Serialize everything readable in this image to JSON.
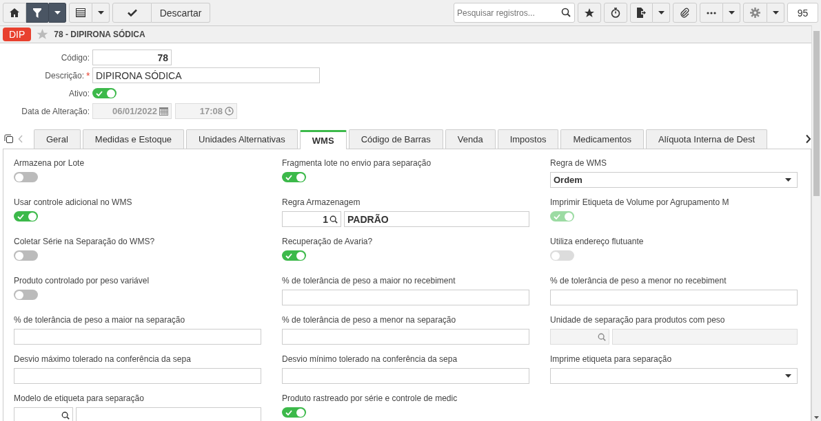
{
  "toolbar": {
    "discard_label": "Descartar",
    "search": {
      "placeholder": "Pesquisar registros..."
    },
    "record_count": "95"
  },
  "record": {
    "badge": "DIP",
    "title": "78 - DIPIRONA SÓDICA",
    "favorite": false
  },
  "header_form": {
    "code": {
      "label": "Código:",
      "value": "78"
    },
    "description": {
      "label": "Descrição:",
      "value": "DIPIRONA SÓDICA",
      "required_mark": "*"
    },
    "active": {
      "label": "Ativo:",
      "on": true
    },
    "modified": {
      "label": "Data de Alteração:",
      "date": "06/01/2022",
      "time": "17:08"
    }
  },
  "tabs": [
    {
      "label": "Geral",
      "selected": false
    },
    {
      "label": "Medidas e Estoque",
      "selected": false
    },
    {
      "label": "Unidades Alternativas",
      "selected": false
    },
    {
      "label": "WMS",
      "selected": true
    },
    {
      "label": "Código de Barras",
      "selected": false
    },
    {
      "label": "Venda",
      "selected": false
    },
    {
      "label": "Impostos",
      "selected": false
    },
    {
      "label": "Medicamentos",
      "selected": false
    },
    {
      "label": "Alíquota Interna de Dest",
      "selected": false
    }
  ],
  "fields": [
    {
      "kind": "toggle",
      "label": "Armazena por Lote",
      "on": false,
      "disabled": false
    },
    {
      "kind": "toggle",
      "label": "Fragmenta lote no envio para separação",
      "on": true,
      "disabled": false
    },
    {
      "kind": "select",
      "label": "Regra de WMS",
      "value": "Ordem"
    },
    {
      "kind": "toggle",
      "label": "Usar controle adicional no WMS",
      "on": true,
      "disabled": false
    },
    {
      "kind": "lookup",
      "label": "Regra Armazenagem",
      "code": "1",
      "value": "PADRÃO",
      "disabled": false
    },
    {
      "kind": "toggle",
      "label": "Imprimir Etiqueta de Volume por Agrupamento M",
      "on": true,
      "disabled": true
    },
    {
      "kind": "toggle",
      "label": "Coletar Série na Separação do WMS?",
      "on": false,
      "disabled": false
    },
    {
      "kind": "toggle",
      "label": "Recuperação de Avaria?",
      "on": true,
      "disabled": false
    },
    {
      "kind": "toggle",
      "label": "Utiliza endereço flutuante",
      "on": false,
      "disabled": true
    },
    {
      "kind": "toggle",
      "label": "Produto controlado por peso variável",
      "on": false,
      "disabled": false
    },
    {
      "kind": "text",
      "label": "% de tolerância de peso a maior no recebiment"
    },
    {
      "kind": "text",
      "label": "% de tolerância de peso a menor no recebiment"
    },
    {
      "kind": "text",
      "label": "% de tolerância de peso a maior na separação"
    },
    {
      "kind": "text",
      "label": "% de tolerância de peso a menor na separação"
    },
    {
      "kind": "lookup",
      "label": "Unidade de separação para produtos com peso",
      "disabled": true
    },
    {
      "kind": "text",
      "label": "Desvio máximo tolerado na conferência da sepa"
    },
    {
      "kind": "text",
      "label": "Desvio mínimo tolerado na conferência da sepa"
    },
    {
      "kind": "select",
      "label": "Imprime etiqueta para separação"
    },
    {
      "kind": "lookup",
      "label": "Modelo de etiqueta para separação",
      "disabled": false
    },
    {
      "kind": "toggle",
      "label": "Produto rastreado por série e controle de medic",
      "on": true,
      "disabled": false
    }
  ]
}
